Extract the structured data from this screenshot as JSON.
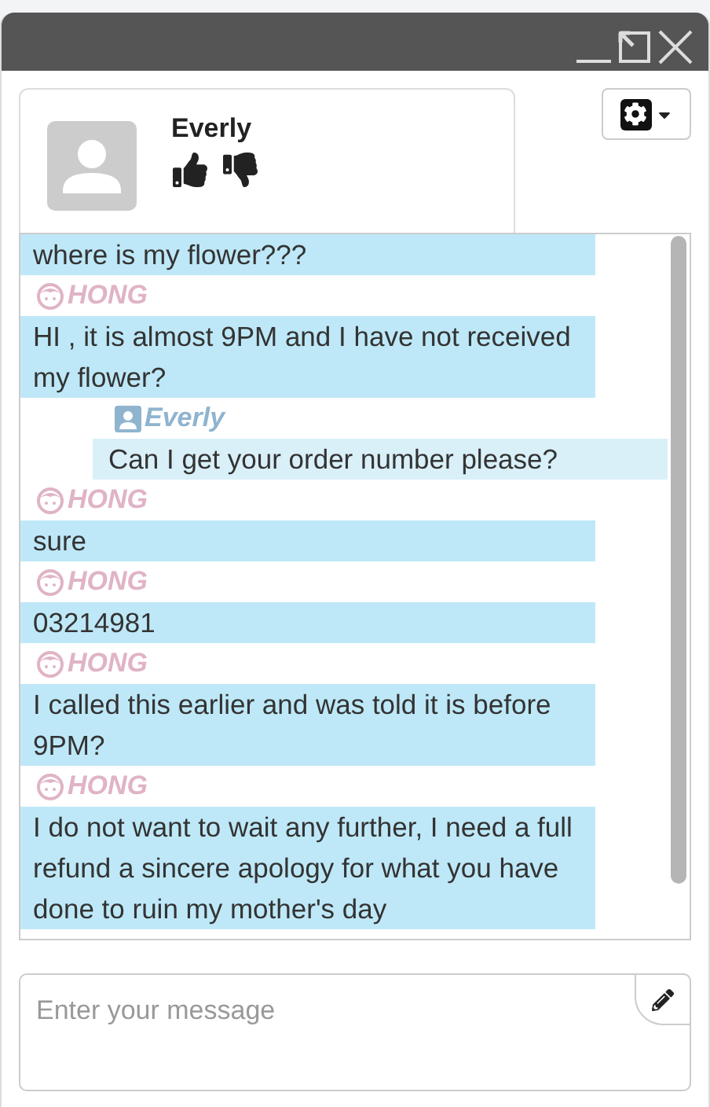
{
  "contact": {
    "name": "Everly"
  },
  "messages": [
    {
      "kind": "customer",
      "text": "where is my flower???"
    },
    {
      "kind": "customer",
      "sender": "HONG",
      "text": "HI , it is almost 9PM and I have not received my flower?"
    },
    {
      "kind": "agent",
      "sender": "Everly",
      "text": "Can I get your order number please?"
    },
    {
      "kind": "customer",
      "sender": "HONG",
      "text": "sure"
    },
    {
      "kind": "customer",
      "sender": "HONG",
      "text": "03214981"
    },
    {
      "kind": "customer",
      "sender": "HONG",
      "text": "I called this earlier and was told it is before 9PM?"
    },
    {
      "kind": "customer",
      "sender": "HONG",
      "text": "I do not want to wait any further, I need a full refund a sincere apology for what you have done to ruin my mother's day"
    }
  ],
  "composer": {
    "placeholder": "Enter your message"
  }
}
